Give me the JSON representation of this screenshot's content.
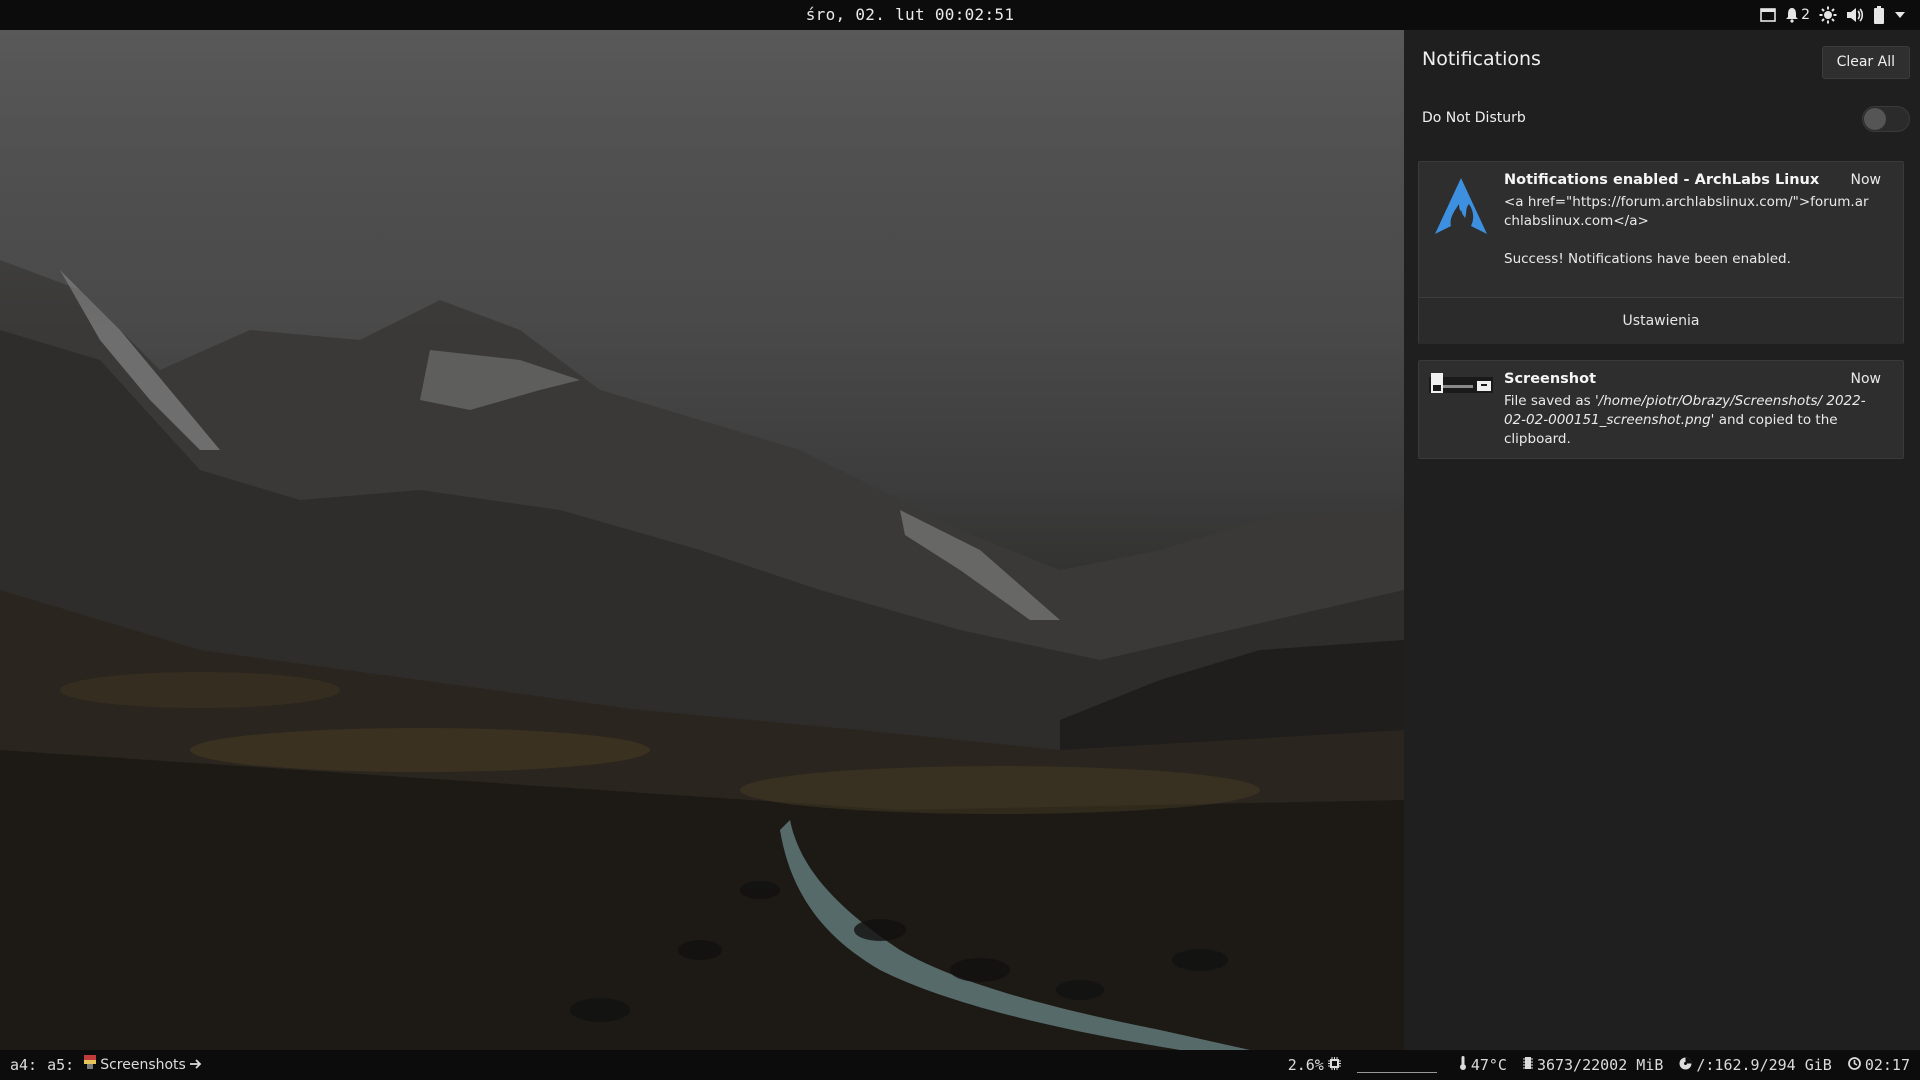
{
  "topbar": {
    "clock": "śro, 02. lut  00:02:51",
    "notification_count": "2",
    "icons": [
      "window-icon",
      "bell-icon",
      "brightness-icon",
      "volume-icon",
      "battery-icon",
      "chevron-down-icon"
    ]
  },
  "panel": {
    "title": "Notifications",
    "clear_all": "Clear All",
    "dnd_label": "Do Not Disturb",
    "dnd_enabled": false,
    "notifications": [
      {
        "icon": "archlabs-logo-icon",
        "summary": "Notifications enabled - ArchLabs Linux",
        "time": "Now",
        "body_line1": "<a href=\"https://forum.archlabslinux.com/\">forum.archlabslinux.com</a>",
        "body_line2": "Success! Notifications have been enabled.",
        "action": "Ustawienia"
      },
      {
        "icon": "screenshot-thumbnail-icon",
        "summary": "Screenshot",
        "time": "Now",
        "body_prefix": "File saved as ",
        "body_path": "'/home/piotr/Obrazy/Screenshots/ 2022-02-02-000151_screenshot.png'",
        "body_suffix": " and copied to the clipboard."
      }
    ]
  },
  "bottombar": {
    "workspaces": [
      "a4:",
      "a5:"
    ],
    "task_label": "Screenshots",
    "cpu": "2.6%",
    "temperature": "47°C",
    "memory": "3673/22002 MiB",
    "disk": "/:162.9/294 GiB",
    "uptime": "02:17"
  },
  "colors": {
    "accent_blue": "#3d8fe0",
    "panel_bg": "#1f1f1f",
    "card_bg": "#2e2e2e",
    "bar_bg": "#0c0c0c"
  }
}
